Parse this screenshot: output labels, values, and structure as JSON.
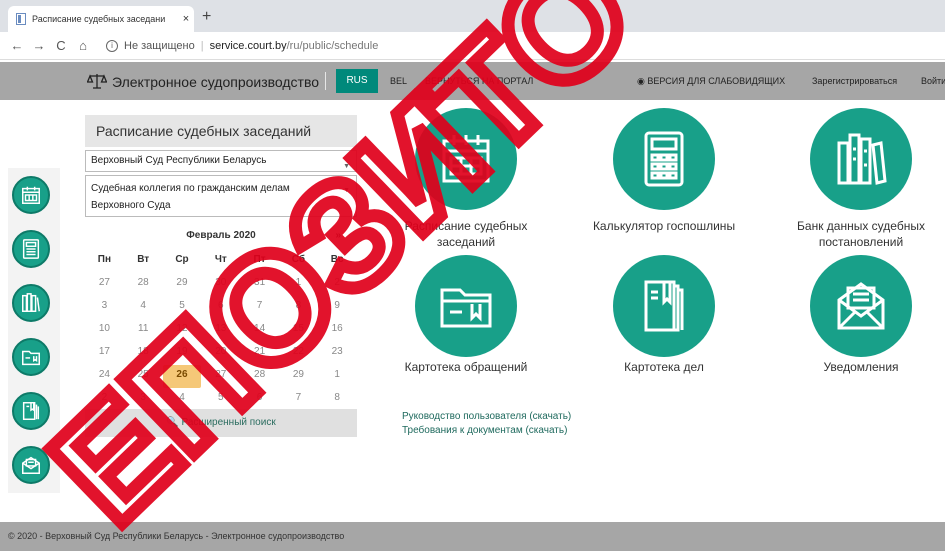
{
  "browser": {
    "tab_title": "Расписание судебных заседани",
    "tab_close": "×",
    "new_tab": "+",
    "security_label": "Не защищено",
    "url_host": "service.court.by",
    "url_path": "/ru/public/schedule",
    "nav": {
      "back": "←",
      "forward": "→",
      "reload": "C",
      "home": "⌂"
    }
  },
  "header": {
    "brand": "Электронное судопроизводство",
    "lang_active": "RUS",
    "lang_other": "BEL",
    "back_to_portal": "ВЕРНУТЬСЯ НА ПОРТАЛ",
    "low_vision": "◉ ВЕРСИЯ ДЛЯ СЛАБОВИДЯЩИХ",
    "register": "Зарегистрироваться",
    "login": "Войти"
  },
  "schedule": {
    "title": "Расписание судебных заседаний",
    "court": "Верховный Суд Республики Беларусь",
    "board_line1": "Судебная коллегия по гражданским делам",
    "board_line2": "Верховного Суда",
    "advanced_search": "🔍 Расширенный поиск"
  },
  "calendar": {
    "month": "Февраль 2020",
    "next": "»",
    "weekdays": [
      "Пн",
      "Вт",
      "Ср",
      "Чт",
      "Пт",
      "Сб",
      "Вс"
    ],
    "weeks": [
      [
        "27",
        "28",
        "29",
        "30",
        "31",
        "1",
        "2"
      ],
      [
        "3",
        "4",
        "5",
        "6",
        "7",
        "8",
        "9"
      ],
      [
        "10",
        "11",
        "12",
        "13",
        "14",
        "15",
        "16"
      ],
      [
        "17",
        "18",
        "19",
        "20",
        "21",
        "22",
        "23"
      ],
      [
        "24",
        "25",
        "26",
        "27",
        "28",
        "29",
        "1"
      ],
      [
        "2",
        "3",
        "4",
        "5",
        "6",
        "7",
        "8"
      ]
    ],
    "today": "26"
  },
  "services": [
    {
      "label_line1": "Расписание судебных",
      "label_line2": "заседаний",
      "icon": "calendar-icon"
    },
    {
      "label_line1": "Калькулятор госпошлины",
      "label_line2": "",
      "icon": "calculator-icon"
    },
    {
      "label_line1": "Банк данных судебных",
      "label_line2": "постановлений",
      "icon": "books-icon"
    },
    {
      "label_line1": "Картотека обращений",
      "label_line2": "",
      "icon": "folder-icon"
    },
    {
      "label_line1": "Картотека дел",
      "label_line2": "",
      "icon": "case-file-icon"
    },
    {
      "label_line1": "Уведомления",
      "label_line2": "",
      "icon": "envelope-icon"
    }
  ],
  "links": {
    "user_guide": "Руководство пользователя (скачать)",
    "doc_requirements": "Требования к документам (скачать)"
  },
  "footer": {
    "text": "© 2020 - Верховный Суд Республики Беларусь - Электронное судопроизводство"
  },
  "watermark": {
    "text": "ЕПОЗИТО",
    "color": "#e0001b"
  },
  "colors": {
    "accent": "#18a089",
    "header_bg": "#a6a6a6",
    "today": "#f5c878"
  }
}
